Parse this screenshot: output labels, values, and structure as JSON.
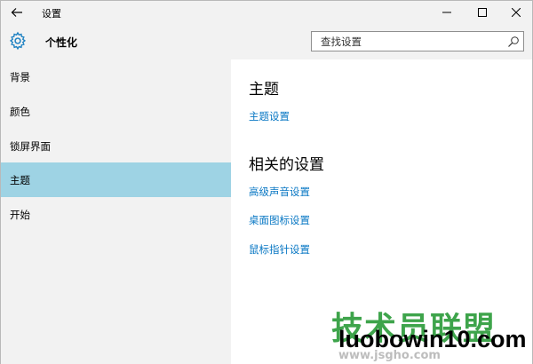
{
  "window": {
    "app_title": "设置"
  },
  "header": {
    "title": "个性化",
    "icon": "gear-icon"
  },
  "search": {
    "placeholder": "查找设置"
  },
  "sidebar": {
    "items": [
      {
        "label": "背景",
        "active": false
      },
      {
        "label": "颜色",
        "active": false
      },
      {
        "label": "锁屏界面",
        "active": false
      },
      {
        "label": "主题",
        "active": true
      },
      {
        "label": "开始",
        "active": false
      }
    ]
  },
  "main": {
    "theme_heading": "主题",
    "theme_link": "主题设置",
    "related_heading": "相关的设置",
    "related_links": [
      "高级声音设置",
      "桌面图标设置",
      "鼠标指针设置"
    ]
  },
  "watermark": {
    "cn": "技术员联盟",
    "en": "luobowin10.com",
    "en2": "www.jsgho.com"
  },
  "colors": {
    "accent": "#0a78c4",
    "selected_item": "#9ed3e4",
    "pane_bg": "#f2f2f2",
    "watermark_green": "#2e9d3c"
  }
}
